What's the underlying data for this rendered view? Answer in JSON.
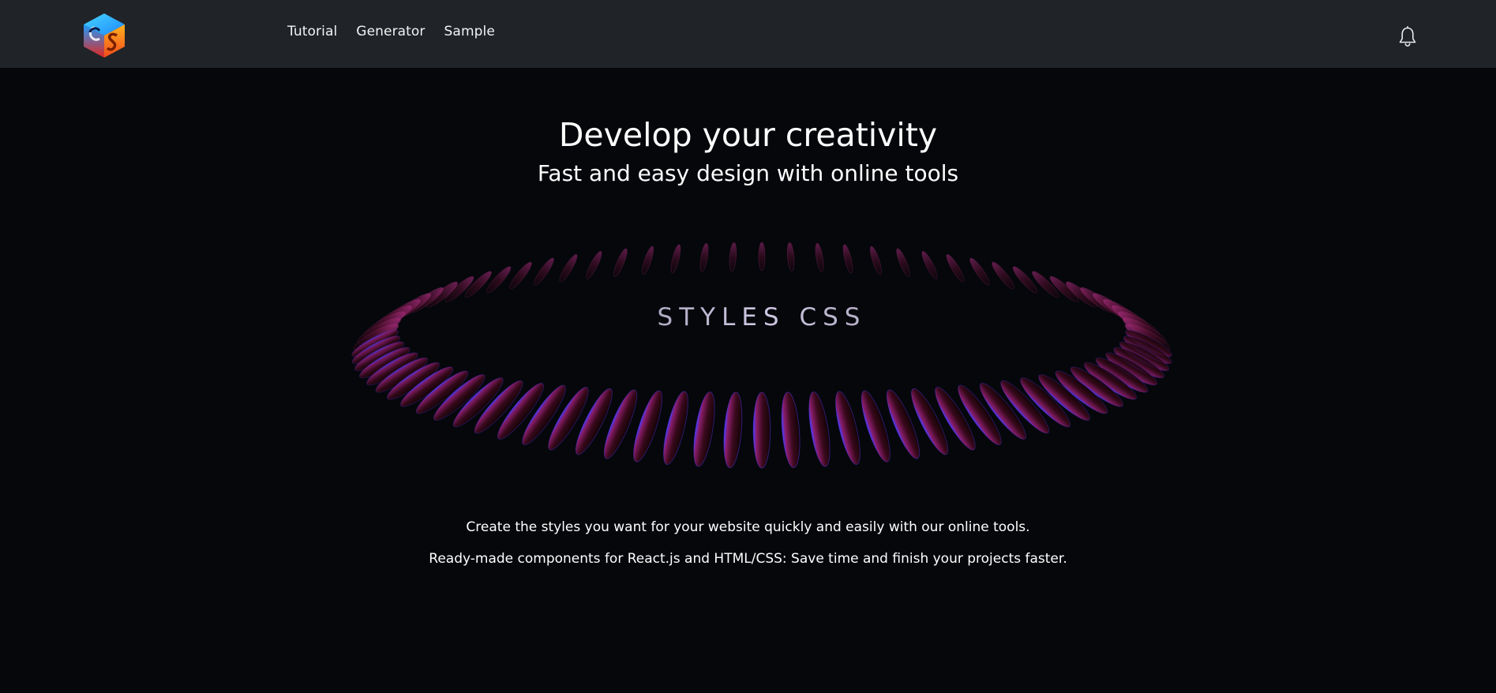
{
  "header": {
    "logo_icon": "styles-css-cube-logo-icon",
    "nav": [
      {
        "label": "Tutorial"
      },
      {
        "label": "Generator"
      },
      {
        "label": "Sample"
      }
    ],
    "notifications_icon": "bell-icon"
  },
  "hero": {
    "title": "Develop your creativity",
    "subtitle": "Fast and easy design with online tools",
    "ring_text": "STYLES  CSS"
  },
  "description": {
    "line1": "Create the styles you want for your website quickly and easily with our online tools.",
    "line2": "Ready-made components for React.js and HTML/CSS: Save time and finish your projects faster."
  },
  "colors": {
    "page_background": "#05070b",
    "header_background": "#202328",
    "text": "#ffffff",
    "ring_primary": "#8a1d6a",
    "ring_accent": "#5a3cff",
    "ring_dark": "#1a0508"
  }
}
